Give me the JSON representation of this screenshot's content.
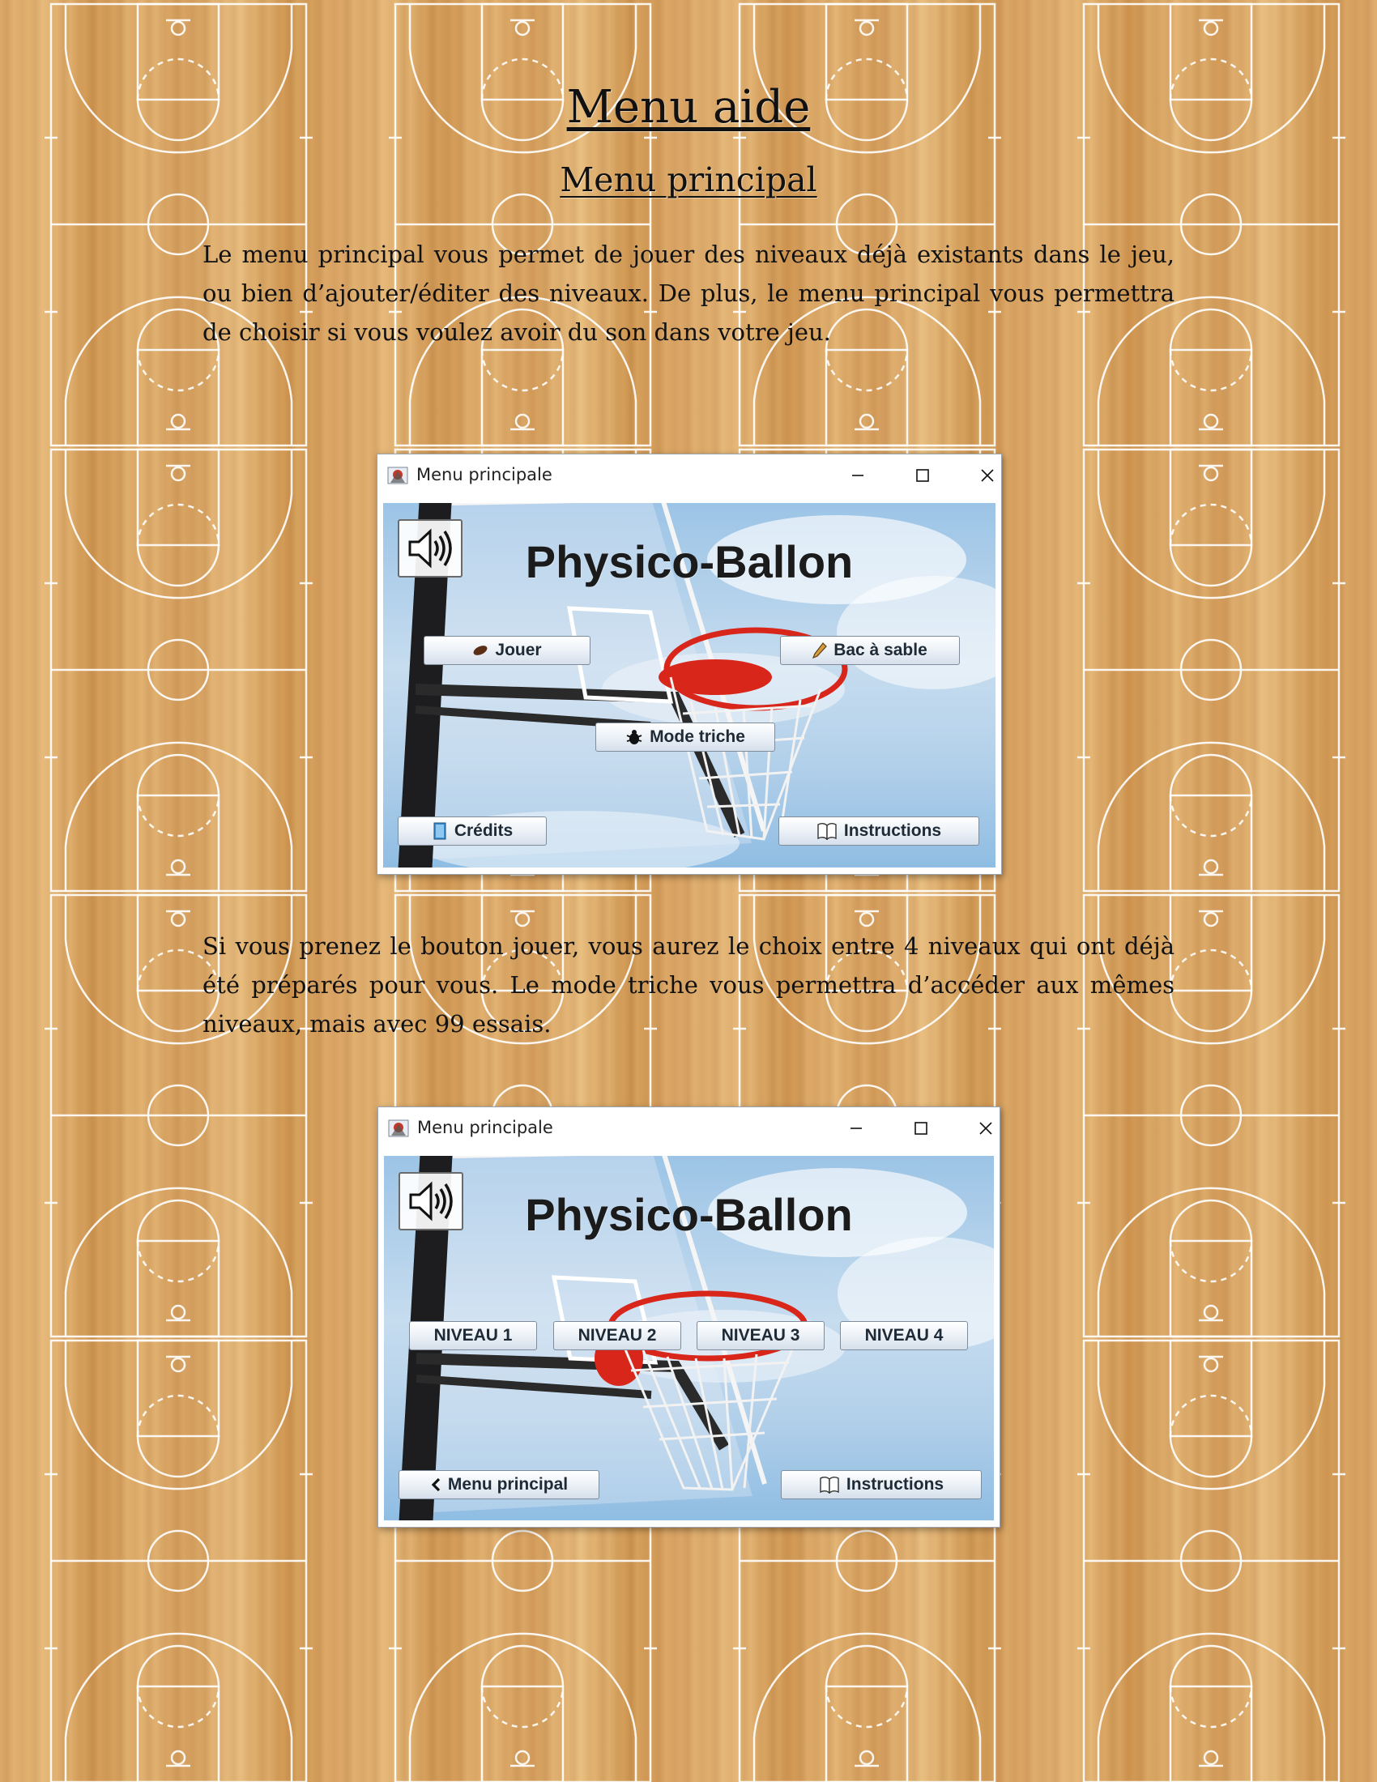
{
  "document": {
    "title": "Menu aide",
    "subtitle": "Menu principal",
    "paragraphs": [
      "Le menu principal vous permet de jouer des niveaux déjà existants dans le jeu, ou bien d’ajouter/éditer des niveaux. De plus, le menu principal vous permettra de choisir si vous voulez avoir du son dans votre jeu.",
      "Si vous prenez le bouton jouer, vous aurez le choix entre 4 niveaux qui ont déjà été préparés pour vous. Le mode triche vous permettra d’accéder aux mêmes niveaux, mais avec 99 essais."
    ]
  },
  "colors": {
    "button_text": "#1e2a36",
    "rim": "#d8261b",
    "sky": "#9cc4e6",
    "wood": "#d9a565"
  },
  "screenshot_1": {
    "window_title": "Menu principale",
    "controls": [
      "minimize-icon",
      "maximize-icon",
      "close-icon"
    ],
    "game_title": "Physico-Ballon",
    "sound_icon": "speaker-icon",
    "buttons": {
      "play": {
        "label": "Jouer",
        "icon": "ball-icon"
      },
      "sandbox": {
        "label": "Bac à sable",
        "icon": "pencil-icon"
      },
      "cheat": {
        "label": "Mode triche",
        "icon": "bug-icon"
      },
      "credits": {
        "label": "Crédits",
        "icon": "book-icon"
      },
      "instructions": {
        "label": "Instructions",
        "icon": "open-book-icon"
      }
    }
  },
  "screenshot_2": {
    "window_title": "Menu principale",
    "controls": [
      "minimize-icon",
      "maximize-icon",
      "close-icon"
    ],
    "game_title": "Physico-Ballon",
    "sound_icon": "speaker-icon",
    "levels": [
      "NIVEAU 1",
      "NIVEAU 2",
      "NIVEAU 3",
      "NIVEAU 4"
    ],
    "buttons": {
      "back": {
        "label": "Menu principal",
        "icon": "chevron-left-icon"
      },
      "instructions": {
        "label": "Instructions",
        "icon": "open-book-icon"
      }
    }
  }
}
